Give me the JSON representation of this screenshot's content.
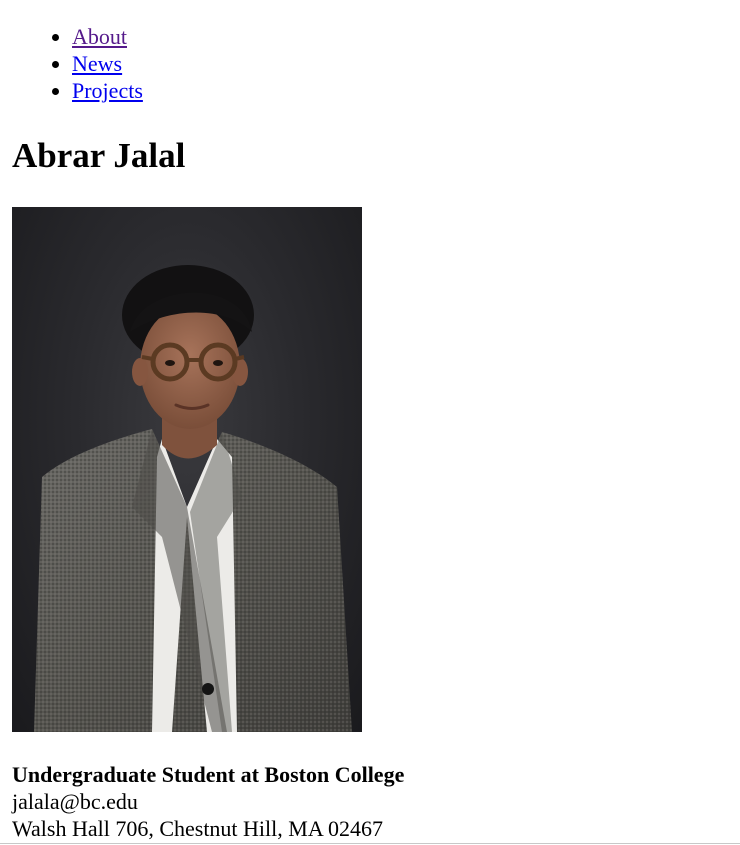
{
  "nav": {
    "items": [
      {
        "label": "About",
        "state": "visited"
      },
      {
        "label": "News",
        "state": "link"
      },
      {
        "label": "Projects",
        "state": "link"
      }
    ]
  },
  "header": {
    "title": "Abrar Jalal"
  },
  "profile": {
    "photo_icon": "portrait-photo",
    "role": "Undergraduate Student at Boston College",
    "email": "jalala@bc.edu",
    "address": "Walsh Hall 706, Chestnut Hill, MA 02467"
  },
  "colors": {
    "link": "#0000ee",
    "visited_link": "#551a8b",
    "photo_background": "#2a2a2e"
  }
}
